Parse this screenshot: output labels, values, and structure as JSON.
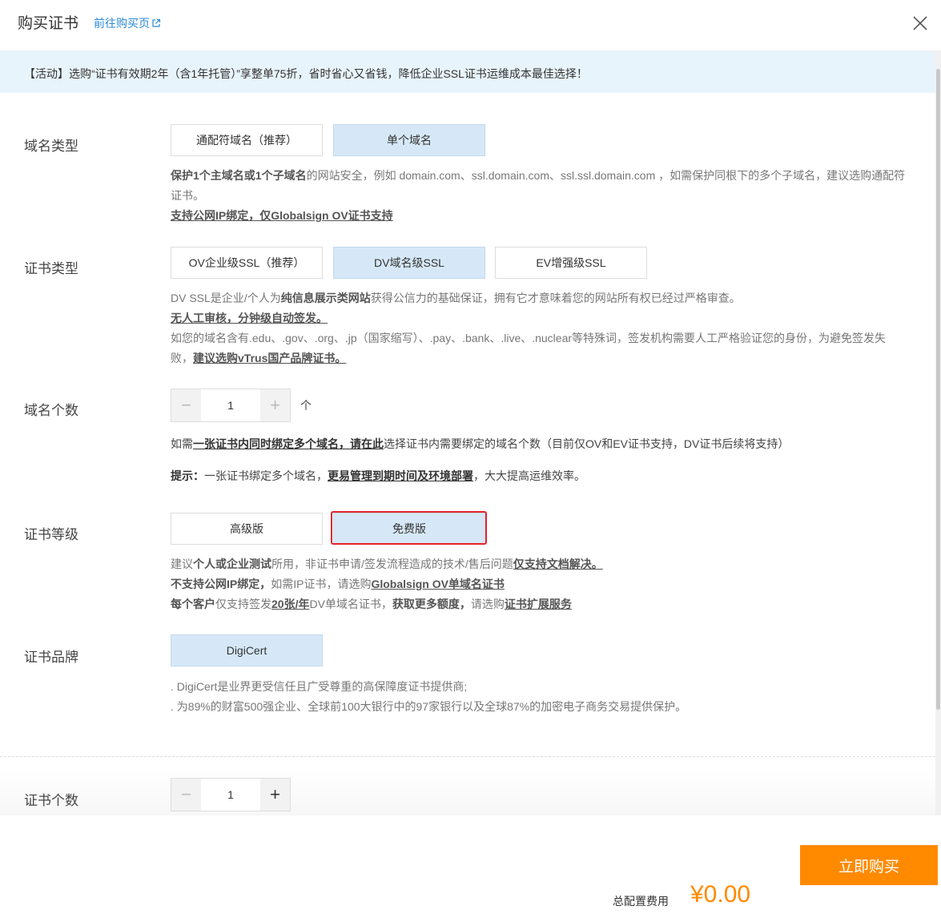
{
  "header": {
    "title": "购买证书",
    "link_label": "前往购买页"
  },
  "banner": {
    "text": "【活动】选购“证书有效期2年（含1年托管）”享整单75折，省时省心又省钱，降低企业SSL证书运维成本最佳选择！"
  },
  "domain_type": {
    "label": "域名类型",
    "options": [
      "通配符域名（推荐）",
      "单个域名"
    ],
    "selected": "单个域名",
    "desc_bold": "保护1个主域名或1个子域名",
    "desc_rest": "的网站安全，例如 domain.com、ssl.domain.com、ssl.ssl.domain.com ，如需保护同根下的多个子域名，建议选购通配符证书。",
    "desc_link": "支持公网IP绑定，仅Globalsign OV证书支持"
  },
  "cert_type": {
    "label": "证书类型",
    "options": [
      "OV企业级SSL（推荐）",
      "DV域名级SSL",
      "EV增强级SSL"
    ],
    "selected": "DV域名级SSL",
    "desc_pre": "DV SSL是企业/个人为",
    "desc_bold": "纯信息展示类网站",
    "desc_post": "获得公信力的基础保证，拥有它才意味着您的网站所有权已经过严格审查。",
    "desc_link1": "无人工审核，分钟级自动签发。",
    "desc_line3": "如您的域名含有.edu、.gov、.org、.jp（国家缩写）、.pay、.bank、.live、.nuclear等特殊词，签发机构需要人工严格验证您的身份，为避免签发失败，",
    "desc_link2": "建议选购vTrus国产品牌证书。"
  },
  "domain_count": {
    "label": "域名个数",
    "value": "1",
    "unit": "个",
    "note_pre": "如需",
    "note_link": "一张证书内同时绑定多个域名，请在此",
    "note_post": "选择证书内需要绑定的域名个数（目前仅OV和EV证书支持，DV证书后续将支持）",
    "tip_bold": "提示：",
    "tip_pre": "一张证书绑定多个域名，",
    "tip_link": "更易管理到期时间及环境部署",
    "tip_post": "，大大提高运维效率。"
  },
  "cert_level": {
    "label": "证书等级",
    "options": [
      "高级版",
      "免费版"
    ],
    "selected": "免费版",
    "l1_a": "建议",
    "l1_b": "个人或企业测试",
    "l1_c": "所用，非证书申请/签发流程造成的技术/售后问题",
    "l1_d": "仅支持文档解决。",
    "l2_a": "不支持公网IP绑定，",
    "l2_b": "如需IP证书，请选购",
    "l2_c": "Globalsign OV单域名证书",
    "l3_a": "每个客户",
    "l3_b": "仅支持签发",
    "l3_c": "20张/年",
    "l3_d": "DV单域名证书，",
    "l3_e": "获取更多额度，",
    "l3_f": "请选购",
    "l3_g": "证书扩展服务"
  },
  "cert_brand": {
    "label": "证书品牌",
    "option": "DigiCert",
    "desc1": ". DigiCert是业界更受信任且广受尊重的高保障度证书提供商;",
    "desc2": ". 为89%的财富500强企业、全球前100大银行中的97家银行以及全球87%的加密电子商务交易提供保护。"
  },
  "cert_count": {
    "label": "证书个数",
    "value": "1"
  },
  "footer": {
    "buy_label": "立即购买",
    "total_label": "总配置费用",
    "total_price": "¥0.00"
  },
  "colors": {
    "accent": "#ff8a00",
    "selected_bg": "#d6e8f7",
    "banner_bg": "#e8f4fb",
    "link": "#2a8ad6",
    "highlight": "#e6232c"
  }
}
